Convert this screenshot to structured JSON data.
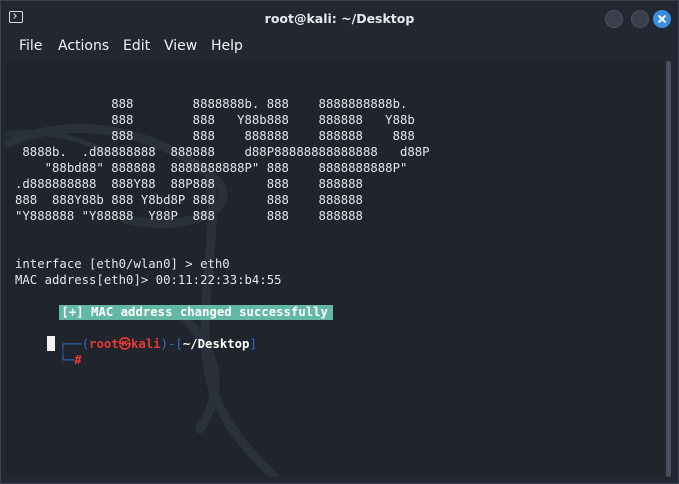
{
  "window": {
    "title": "root@kali: ~/Desktop"
  },
  "icons": {
    "app": "terminal-icon",
    "minimize": "minimize-icon",
    "maximize": "maximize-icon",
    "close": "close-icon"
  },
  "menu": {
    "file": "File",
    "actions": "Actions",
    "edit": "Edit",
    "view": "View",
    "help": "Help"
  },
  "terminal": {
    "banner": [
      "             888        8888888b. 888    8888888888b.",
      "             888        888   Y88b888    888888   Y88b",
      "             888        888    888888    888888    888",
      " 8888b.  .d88888888  888888    d88P88888888888888   d88P",
      "    \"88bd88\" 888888  8888888888P\" 888    8888888888P\"",
      ".d888888888  888Y88  88P888       888    888888",
      "888  888Y88b 888 Y8bd8P 888       888    888888",
      "\"Y888888 \"Y88888  Y88P  888       888    888888"
    ],
    "output": {
      "interface_prompt": "interface [eth0/wlan0] > eth0",
      "mac_line": "MAC address[eth0]> 00:11:22:33:b4:55",
      "success": "[+] MAC address changed successfully"
    },
    "prompt": {
      "line1_open": "┌──(",
      "user": "root",
      "at_symbol": "㉿",
      "host": "kali",
      "mid": ")-[",
      "path": "~/Desktop",
      "close": "]",
      "line2": "└─#"
    }
  },
  "colors": {
    "background": "#20242c",
    "titlebar": "#232731",
    "success_highlight": "#62b8a4",
    "prompt_bracket": "#2e6ccf",
    "prompt_root": "#e53935",
    "close_button": "#3b8de0"
  }
}
